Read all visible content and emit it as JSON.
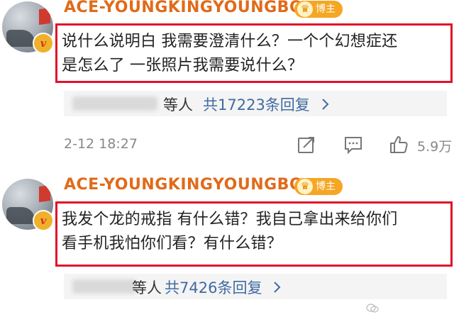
{
  "comments": [
    {
      "username": "ACE-YOUNGKINGYOUNGBO...",
      "badge": "博主",
      "avatar_badge": "v",
      "text_line1": "说什么说明白 我需要澄清什么？一个个幻想症还",
      "text_line2": "是怎么了 一张照片我需要说什么？",
      "replies_suffix": "等人",
      "reply_count_text": "共17223条回复",
      "time": "2-12 18:27",
      "likes": "5.9万"
    },
    {
      "username": "ACE-YOUNGKINGYOUNGBO...",
      "badge": "博主",
      "avatar_badge": "v",
      "text_line1": "我发个龙的戒指 有什么错？我自己拿出来给你们",
      "text_line2": "看手机我怕你们看？有什么错？",
      "replies_suffix": "等人",
      "reply_count_text": "共7426条回复"
    }
  ],
  "icons": {
    "share": "share-icon",
    "comment": "comment-icon",
    "like": "thumbs-up-icon",
    "crown": "crown-icon",
    "chevron": "chevron-right-icon"
  },
  "colors": {
    "username": "#e06b1a",
    "highlight_border": "#e0122a",
    "link": "#3f6ba3",
    "badge": "#f5a623"
  }
}
